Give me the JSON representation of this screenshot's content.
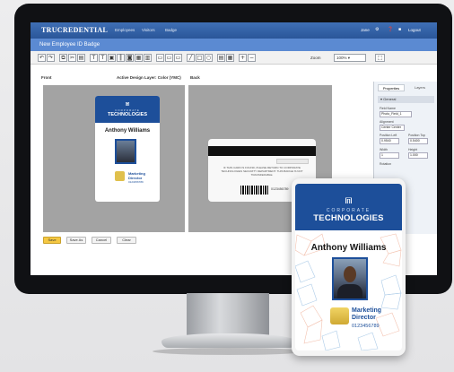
{
  "app": {
    "logo": "TRUCREDENTIAL",
    "menu": [
      "Employees",
      "Visitors",
      "Badge"
    ],
    "top_right": [
      "Jane",
      "⚙",
      "❓",
      "■",
      "Logout"
    ],
    "page_title": "New Employee ID Badge",
    "zoom_value": "100%"
  },
  "toolbar_icons": [
    "undo-icon",
    "redo-icon",
    "copy-icon",
    "cut-icon",
    "paste-icon",
    "text-icon",
    "text-box-icon",
    "image-icon",
    "barcode-icon",
    "photo-icon",
    "qr-icon",
    "layer-icon",
    "align-icon",
    "line-icon",
    "rectangle-icon",
    "ellipse-icon",
    "table-icon",
    "grid-icon",
    "zoom-in-icon",
    "zoom-out-icon",
    "fit-icon"
  ],
  "design": {
    "front_label": "Front",
    "active_layer_label": "Active Design Layer: Color (YMC)",
    "back_label": "Back"
  },
  "badge": {
    "corp_line": "CORPORATE",
    "company": "TECHNOLOGIES",
    "name": "Anthony Williams",
    "title_line1": "Marketing",
    "title_line2": "Director",
    "phone": "0123456789"
  },
  "back_card": {
    "text": "IF THIS CARD IS FOUND, PLEASE RETURN TO CORPORATE TECHNOLOGIES SECURITY DEPARTMENT. THIS BADGE IS NOT TRANSFERABLE."
  },
  "properties_panel": {
    "tabs": [
      "Properties",
      "Layers"
    ],
    "section": "General",
    "field_name_label": "Field Name",
    "field_name_value": "Photo_Field_1",
    "alignment_label": "Alignment",
    "alignment_value": "Center Center",
    "pos_left_label": "Position Left",
    "pos_left_value": "0.9540",
    "pos_top_label": "Position Top",
    "pos_top_value": "0.5400",
    "width_label": "Width",
    "width_value": "1",
    "height_label": "Height",
    "height_value": "1.000",
    "rotation_label": "Rotation"
  },
  "action_buttons": [
    "Save",
    "Save As",
    "Cancel",
    "Clear"
  ]
}
